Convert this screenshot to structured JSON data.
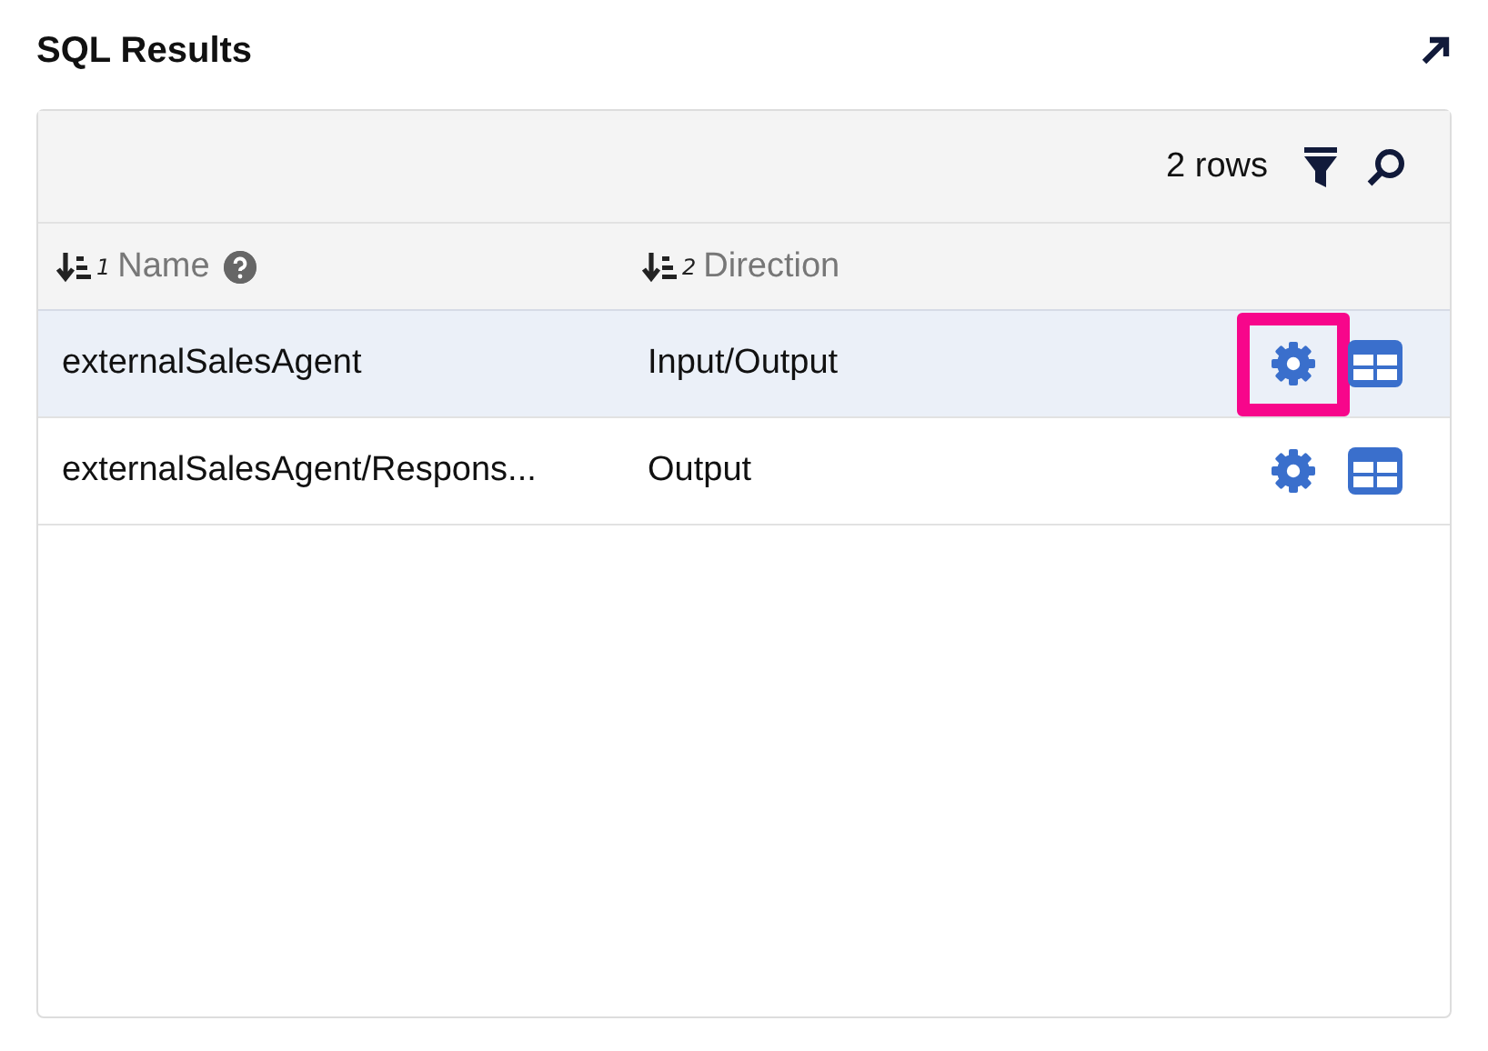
{
  "title": "SQL Results",
  "toolbar": {
    "row_count": "2 rows"
  },
  "columns": [
    {
      "label": "Name",
      "sort_order": "1",
      "help": true
    },
    {
      "label": "Direction",
      "sort_order": "2",
      "help": false
    }
  ],
  "rows": [
    {
      "name": "externalSalesAgent",
      "direction": "Input/Output",
      "selected": true,
      "highlighted": true
    },
    {
      "name": "externalSalesAgent/Respons...",
      "direction": "Output",
      "selected": false,
      "highlighted": false
    }
  ]
}
